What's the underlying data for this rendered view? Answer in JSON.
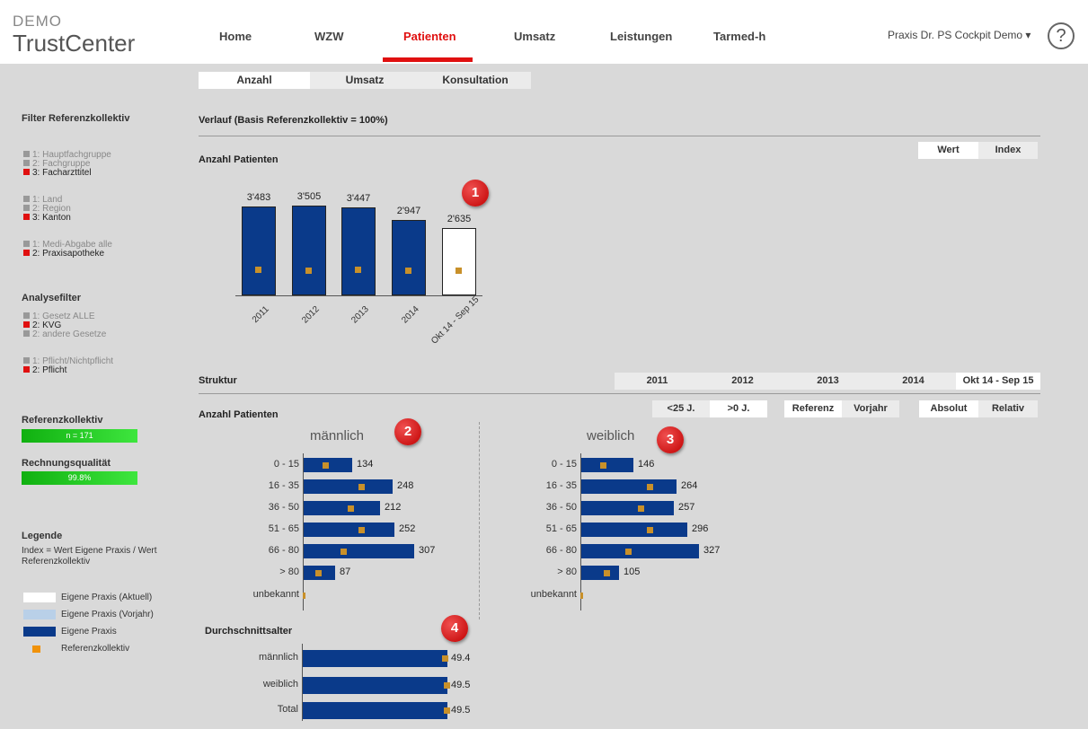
{
  "header": {
    "brand_small": "DEMO",
    "brand_big": "TrustCenter",
    "nav": [
      "Home",
      "WZW",
      "Patienten",
      "Umsatz",
      "Leistungen",
      "Tarmed-h"
    ],
    "active_nav": "Patienten",
    "practice": "Praxis Dr. PS Cockpit Demo ▾",
    "help": "?"
  },
  "subtabs": [
    "Anzahl",
    "Umsatz",
    "Konsultation"
  ],
  "left": {
    "filter_title": "Filter Referenzkollektiv",
    "filter_groups": [
      [
        {
          "label": "1: Hauptfachgruppe",
          "on": false
        },
        {
          "label": "2: Fachgruppe",
          "on": false
        },
        {
          "label": "3: Facharzttitel",
          "on": true
        }
      ],
      [
        {
          "label": "1: Land",
          "on": false
        },
        {
          "label": "2: Region",
          "on": false
        },
        {
          "label": "3: Kanton",
          "on": true
        }
      ],
      [
        {
          "label": "1: Medi-Abgabe alle",
          "on": false
        },
        {
          "label": "2: Praxisapotheke",
          "on": true
        }
      ]
    ],
    "analyse_title": "Analysefilter",
    "analyse_groups": [
      [
        {
          "label": "1: Gesetz ALLE",
          "on": false
        },
        {
          "label": "2: KVG",
          "on": true
        },
        {
          "label": "2: andere Gesetze",
          "on": false
        }
      ],
      [
        {
          "label": "1: Pflicht/Nichtpflicht",
          "on": false
        },
        {
          "label": "2: Pflicht",
          "on": true
        }
      ]
    ],
    "ref_title": "Referenzkollektiv",
    "ref_value": "n = 171",
    "quality_title": "Rechnungsqualität",
    "quality_value": "99.8%",
    "legend_title": "Legende",
    "legend_text": "Index = Wert Eigene Praxis / Wert Referenzkollektiv",
    "legend_items": [
      {
        "label": "Eigene Praxis (Aktuell)",
        "color": "#ffffff"
      },
      {
        "label": "Eigene Praxis (Vorjahr)",
        "color": "#b9d0e8"
      },
      {
        "label": "Eigene Praxis",
        "color": "#0a3a8a"
      },
      {
        "label": "Referenzkollektiv",
        "color": "#f0920a"
      }
    ]
  },
  "main": {
    "verlauf_title": "Verlauf (Basis Referenzkollektiv = 100%)",
    "anzahl_title": "Anzahl Patienten",
    "wert_btn": "Wert",
    "index_btn": "Index",
    "badges": [
      "1",
      "2",
      "3",
      "4"
    ],
    "struktur_title": "Struktur",
    "years": [
      "2011",
      "2012",
      "2013",
      "2014",
      "Okt 14 - Sep 15"
    ],
    "age_btns": [
      "<25 J.",
      ">0 J."
    ],
    "ref_btns": [
      "Referenz",
      "Vorjahr"
    ],
    "abs_btns": [
      "Absolut",
      "Relativ"
    ],
    "struktur_subtitle": "Anzahl Patienten",
    "maennlich": "männlich",
    "weiblich": "weiblich",
    "durchschnitt_title": "Durchschnittsalter"
  },
  "chart_data": [
    {
      "type": "bar",
      "title": "Anzahl Patienten",
      "categories": [
        "2011",
        "2012",
        "2013",
        "2014",
        "Okt 14 - Sep 15"
      ],
      "series": [
        {
          "values": [
            3483,
            3505,
            3447,
            2947,
            2635
          ],
          "value_labels": [
            "3'483",
            "3'505",
            "3'447",
            "2'947",
            "2'635"
          ]
        },
        {
          "values": [
            1250,
            1220,
            1250,
            1190,
            1200
          ]
        }
      ],
      "ylim": [
        0,
        4300
      ]
    },
    {
      "type": "bar",
      "title": "männlich",
      "categories": [
        "0 - 15",
        "16 - 35",
        "36 - 50",
        "51 - 65",
        "66 - 80",
        "> 80",
        "unbekannt"
      ],
      "series": [
        {
          "values": [
            134,
            248,
            212,
            252,
            307,
            87,
            0
          ]
        },
        {
          "values": [
            60,
            160,
            130,
            160,
            110,
            40,
            5
          ]
        }
      ]
    },
    {
      "type": "bar",
      "title": "weiblich",
      "categories": [
        "0 - 15",
        "16 - 35",
        "36 - 50",
        "51 - 65",
        "66 - 80",
        "> 80",
        "unbekannt"
      ],
      "series": [
        {
          "values": [
            146,
            264,
            257,
            296,
            327,
            105,
            0
          ]
        },
        {
          "values": [
            60,
            190,
            165,
            190,
            130,
            70,
            5
          ]
        }
      ]
    },
    {
      "type": "bar",
      "title": "Durchschnittsalter",
      "categories": [
        "männlich",
        "weiblich",
        "Total"
      ],
      "series": [
        {
          "values": [
            49.4,
            49.5,
            49.5
          ]
        },
        {
          "values": [
            48.0,
            48.5,
            48.5
          ]
        }
      ]
    }
  ]
}
